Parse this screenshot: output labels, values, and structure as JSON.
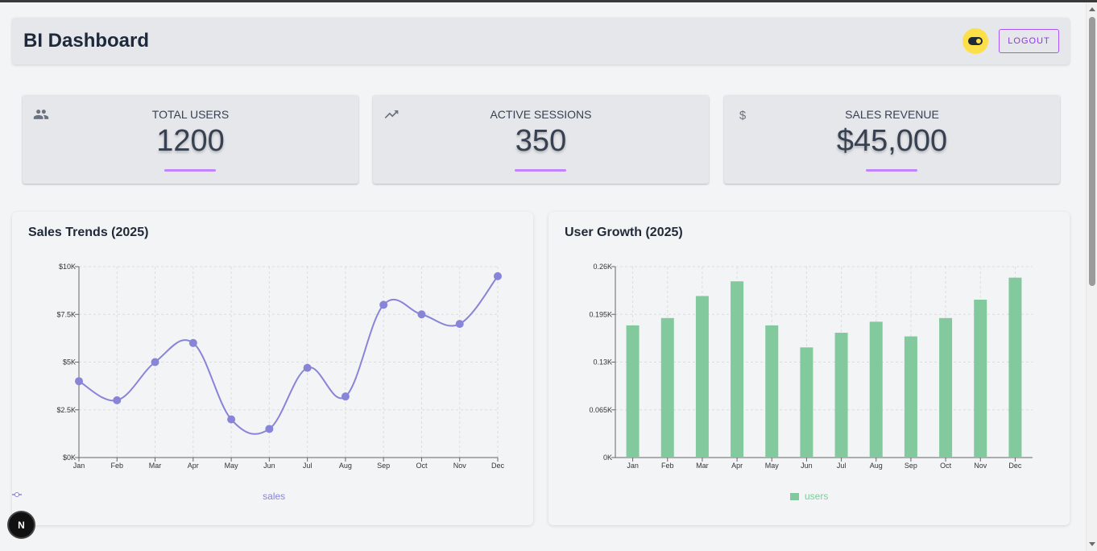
{
  "header": {
    "title": "BI Dashboard",
    "logout_label": "LOGOUT"
  },
  "stats": [
    {
      "label": "TOTAL USERS",
      "value": "1200",
      "icon": "users-icon"
    },
    {
      "label": "ACTIVE SESSIONS",
      "value": "350",
      "icon": "trending-up-icon"
    },
    {
      "label": "SALES REVENUE",
      "value": "$45,000",
      "icon": "dollar-icon"
    }
  ],
  "charts": {
    "sales_title": "Sales Trends (2025)",
    "growth_title": "User Growth (2025)"
  },
  "colors": {
    "line": "#8884d8",
    "bar": "#82ca9d",
    "accent": "#a855f7",
    "toggle": "#fde047"
  },
  "badge": "N",
  "chart_data": [
    {
      "type": "line",
      "title": "Sales Trends (2025)",
      "categories": [
        "Jan",
        "Feb",
        "Mar",
        "Apr",
        "May",
        "Jun",
        "Jul",
        "Aug",
        "Sep",
        "Oct",
        "Nov",
        "Dec"
      ],
      "series": [
        {
          "name": "sales",
          "values": [
            4000,
            3000,
            5000,
            6000,
            2000,
            1500,
            4700,
            3200,
            8000,
            7500,
            7000,
            9500
          ]
        }
      ],
      "yticks": [
        "$0K",
        "$2.5K",
        "$5K",
        "$7.5K",
        "$10K"
      ],
      "ylim": [
        0,
        10000
      ],
      "grid": true,
      "legend": "bottom"
    },
    {
      "type": "bar",
      "title": "User Growth (2025)",
      "categories": [
        "Jan",
        "Feb",
        "Mar",
        "Apr",
        "May",
        "Jun",
        "Jul",
        "Aug",
        "Sep",
        "Oct",
        "Nov",
        "Dec"
      ],
      "series": [
        {
          "name": "users",
          "values": [
            180,
            190,
            220,
            240,
            180,
            150,
            170,
            185,
            165,
            190,
            215,
            245
          ]
        }
      ],
      "yticks": [
        "0K",
        "0.065K",
        "0.13K",
        "0.195K",
        "0.26K"
      ],
      "ylim": [
        0,
        260
      ],
      "grid": true,
      "legend": "bottom"
    }
  ]
}
